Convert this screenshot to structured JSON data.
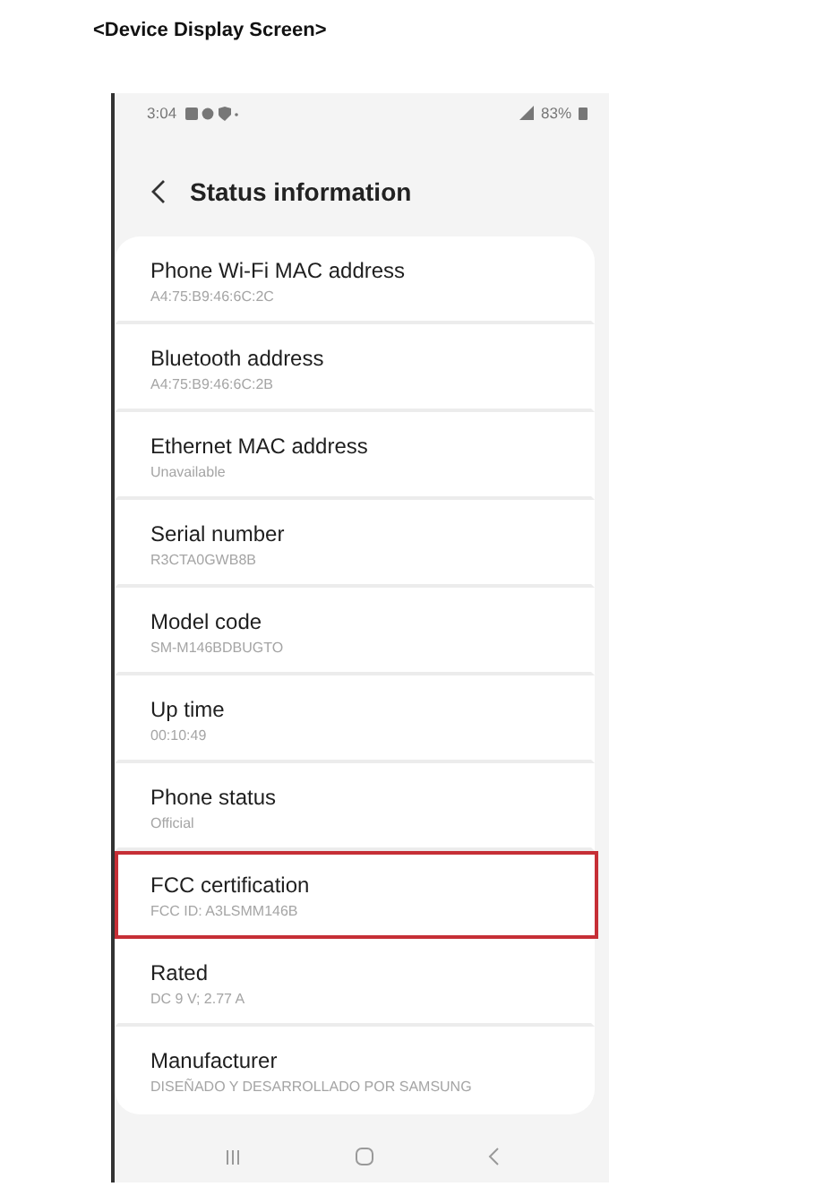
{
  "caption": "<Device Display Screen>",
  "status_bar": {
    "time": "3:04",
    "battery": "83%"
  },
  "header": {
    "title": "Status information"
  },
  "items": [
    {
      "label": "Phone Wi-Fi MAC address",
      "value": "A4:75:B9:46:6C:2C",
      "highlighted": false
    },
    {
      "label": "Bluetooth address",
      "value": "A4:75:B9:46:6C:2B",
      "highlighted": false
    },
    {
      "label": "Ethernet MAC address",
      "value": "Unavailable",
      "highlighted": false
    },
    {
      "label": "Serial number",
      "value": "R3CTA0GWB8B",
      "highlighted": false
    },
    {
      "label": "Model code",
      "value": "SM-M146BDBUGTO",
      "highlighted": false
    },
    {
      "label": "Up time",
      "value": "00:10:49",
      "highlighted": false
    },
    {
      "label": "Phone status",
      "value": "Official",
      "highlighted": false
    },
    {
      "label": "FCC certification",
      "value": "FCC ID: A3LSMM146B",
      "highlighted": true
    },
    {
      "label": "Rated",
      "value": "DC 9 V; 2.77 A",
      "highlighted": false
    },
    {
      "label": "Manufacturer",
      "value": "DISEÑADO Y DESARROLLADO POR SAMSUNG",
      "highlighted": false
    }
  ]
}
